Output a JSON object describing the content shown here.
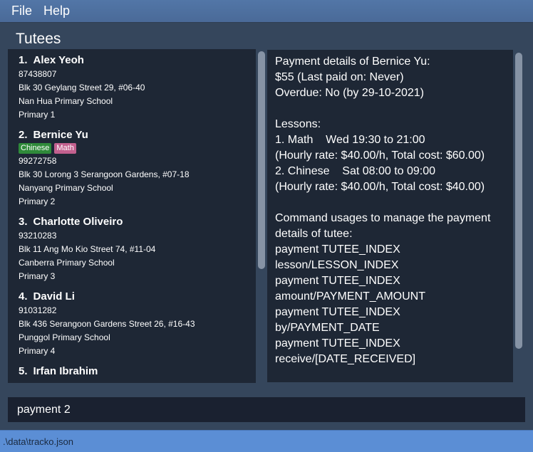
{
  "menu": {
    "file": "File",
    "help": "Help"
  },
  "tutees_title": "Tutees",
  "tutees": [
    {
      "index": "1.",
      "name": "Alex Yeoh",
      "tags": [],
      "phone": "87438807",
      "address": "Blk 30 Geylang Street 29, #06-40",
      "school": "Nan Hua Primary School",
      "level": "Primary 1"
    },
    {
      "index": "2.",
      "name": "Bernice Yu",
      "tags": [
        {
          "label": "Chinese",
          "color": "#2f8a3a"
        },
        {
          "label": "Math",
          "color": "#c2608e"
        }
      ],
      "phone": "99272758",
      "address": "Blk 30 Lorong 3 Serangoon Gardens, #07-18",
      "school": "Nanyang Primary School",
      "level": "Primary 2"
    },
    {
      "index": "3.",
      "name": "Charlotte Oliveiro",
      "tags": [],
      "phone": "93210283",
      "address": "Blk 11 Ang Mo Kio Street 74, #11-04",
      "school": "Canberra Primary School",
      "level": "Primary 3"
    },
    {
      "index": "4.",
      "name": "David Li",
      "tags": [],
      "phone": "91031282",
      "address": "Blk 436 Serangoon Gardens Street 26, #16-43",
      "school": "Punggol Primary School",
      "level": "Primary 4"
    },
    {
      "index": "5.",
      "name": "Irfan Ibrahim",
      "tags": [],
      "phone": "",
      "address": "",
      "school": "",
      "level": ""
    }
  ],
  "details": [
    "Payment details of Bernice Yu:",
    "$55 (Last paid on: Never)",
    "Overdue: No (by 29-10-2021)",
    "",
    "Lessons:",
    "1. Math    Wed 19:30 to 21:00",
    "(Hourly rate: $40.00/h, Total cost: $60.00)",
    "2. Chinese    Sat 08:00 to 09:00",
    "(Hourly rate: $40.00/h, Total cost: $40.00)",
    "",
    "Command usages to manage the payment",
    "details of tutee:",
    "payment TUTEE_INDEX",
    "lesson/LESSON_INDEX",
    "payment TUTEE_INDEX",
    "amount/PAYMENT_AMOUNT",
    "payment TUTEE_INDEX",
    "by/PAYMENT_DATE",
    "payment TUTEE_INDEX",
    "receive/[DATE_RECEIVED]"
  ],
  "command_value": "payment 2",
  "status_path": ".\\data\\tracko.json",
  "colors": {
    "background": "#35465c",
    "panel": "#1e2735",
    "menubar": "#4f72a2",
    "statusbar": "#5b8ed5"
  }
}
